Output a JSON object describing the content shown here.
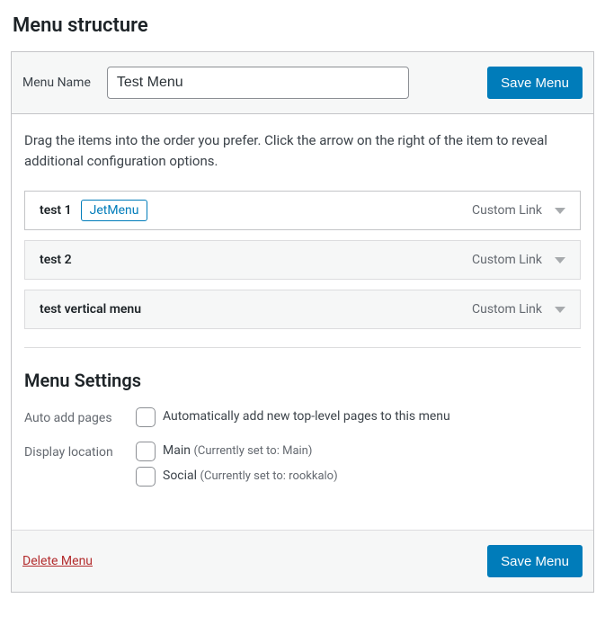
{
  "heading": "Menu structure",
  "nameLabel": "Menu Name",
  "nameValue": "Test Menu",
  "saveLabel": "Save Menu",
  "instructions": "Drag the items into the order you prefer. Click the arrow on the right of the item to reveal additional configuration options.",
  "items": [
    {
      "title": "test 1",
      "type": "Custom Link",
      "tag": "JetMenu",
      "selected": true
    },
    {
      "title": "test 2",
      "type": "Custom Link",
      "selected": false
    },
    {
      "title": "test vertical menu",
      "type": "Custom Link",
      "selected": false
    }
  ],
  "settingsHeading": "Menu Settings",
  "autoAdd": {
    "label": "Auto add pages",
    "text": "Automatically add new top-level pages to this menu"
  },
  "display": {
    "label": "Display location",
    "options": [
      {
        "name": "Main",
        "note": "(Currently set to: Main)"
      },
      {
        "name": "Social",
        "note": "(Currently set to: rookkalo)"
      }
    ]
  },
  "deleteLabel": "Delete Menu"
}
